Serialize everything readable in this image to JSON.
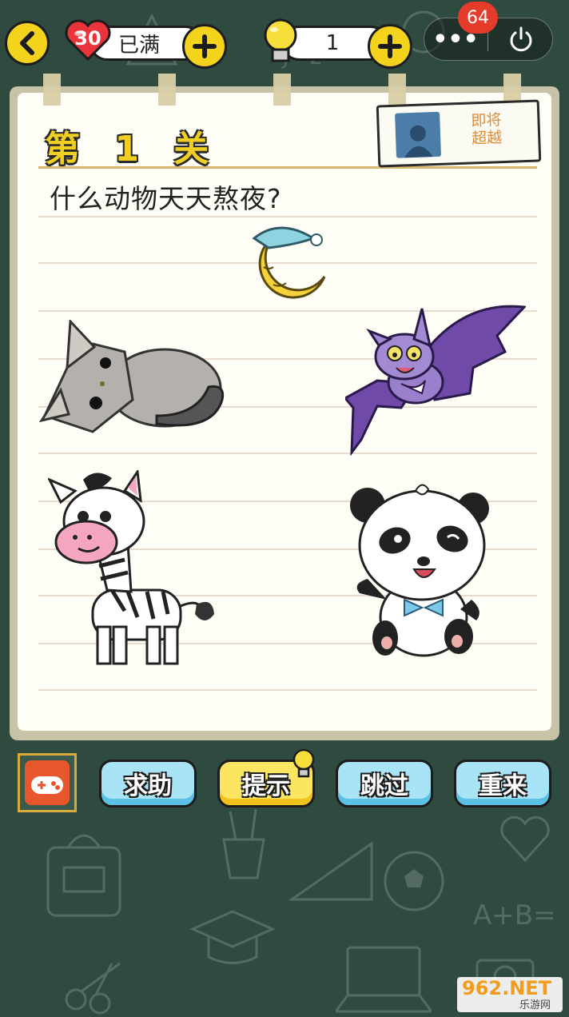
{
  "top_bar": {
    "lives_count": "30",
    "lives_status": "已满",
    "hints_count": "1",
    "notification_count": "64",
    "more_label": "•••"
  },
  "level": {
    "title": "第 1 关",
    "question": "什么动物天天熬夜?"
  },
  "rank_card": {
    "text_line1": "即将",
    "text_line2": "超越"
  },
  "options": [
    {
      "icon": "cat-icon"
    },
    {
      "icon": "bat-icon"
    },
    {
      "icon": "zebra-icon"
    },
    {
      "icon": "panda-icon"
    }
  ],
  "actions": {
    "help": "求助",
    "hint": "提示",
    "skip": "跳过",
    "restart": "重来"
  },
  "watermark": {
    "brand": "962.NET",
    "site": "乐游网"
  },
  "colors": {
    "board": "#2f4a3e",
    "accent_yellow": "#f4d31d",
    "button_blue": "#a8e3f6",
    "button_yellow": "#fbe561"
  }
}
